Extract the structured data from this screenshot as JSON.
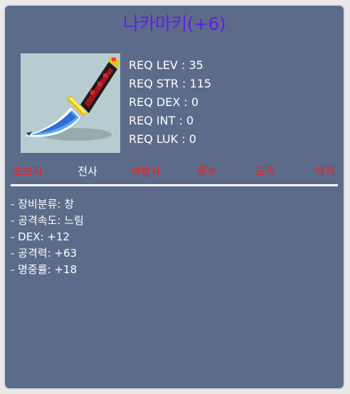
{
  "item": {
    "name": "나카마키(+6)",
    "image_icon": "nakamaki-spear-icon"
  },
  "requirements": [
    {
      "label": "REQ LEV",
      "value": "35"
    },
    {
      "label": "REQ STR",
      "value": "115"
    },
    {
      "label": "REQ DEX",
      "value": "0"
    },
    {
      "label": "REQ INT",
      "value": "0"
    },
    {
      "label": "REQ LUK",
      "value": "0"
    }
  ],
  "jobs": [
    {
      "label": "초보자",
      "allowed": false
    },
    {
      "label": "전사",
      "allowed": true
    },
    {
      "label": "마법사",
      "allowed": false
    },
    {
      "label": "궁수",
      "allowed": false
    },
    {
      "label": "도적",
      "allowed": false
    },
    {
      "label": "해적",
      "allowed": false
    }
  ],
  "stats": [
    "- 장비분류: 창",
    "- 공격속도: 느림",
    "- DEX: +12",
    "- 공격력: +63",
    "- 명중률: +18"
  ],
  "colors": {
    "background": "#5d6b8a",
    "title": "#5b21e8",
    "job_allowed": "#ffffff",
    "job_disallowed": "#ff1a1a"
  }
}
